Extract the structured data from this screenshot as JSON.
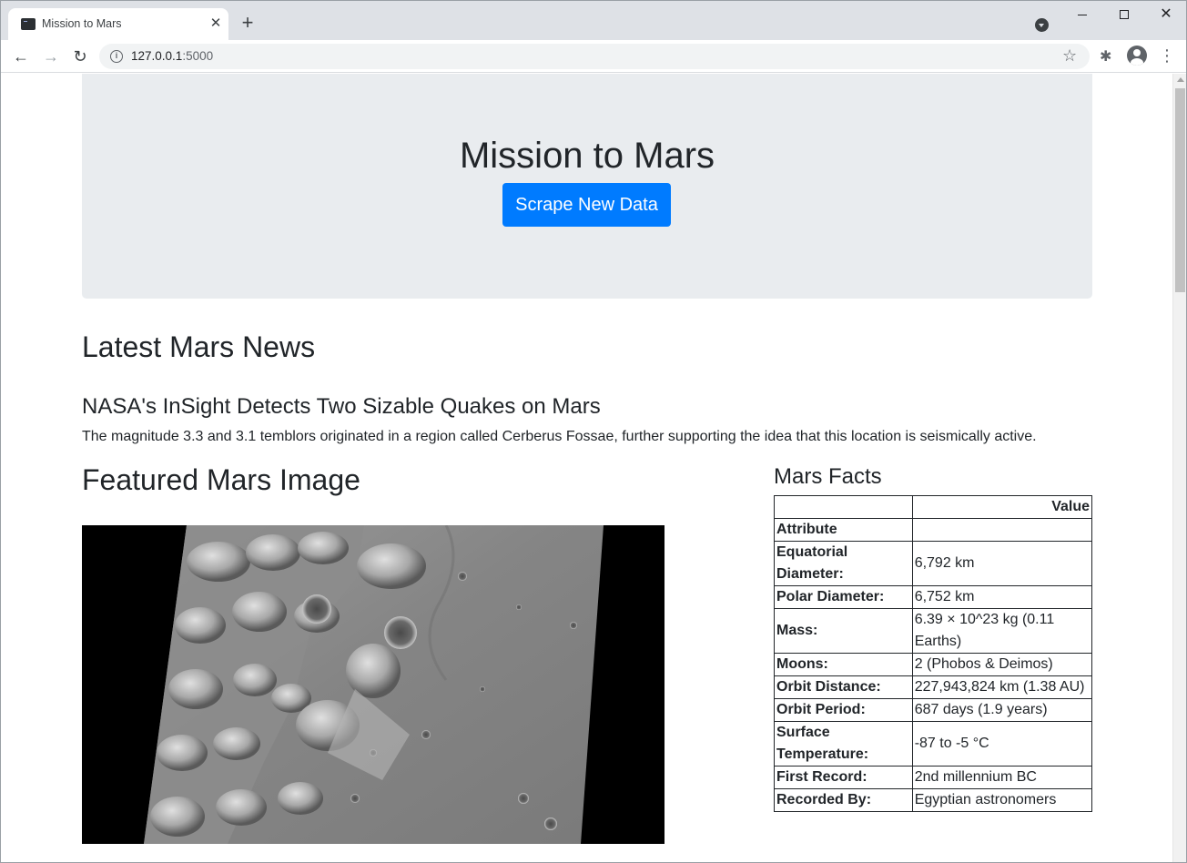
{
  "browser": {
    "tab_title": "Mission to Mars",
    "tab_close_glyph": "✕",
    "new_tab_glyph": "+",
    "url_host": "127.0.0.1",
    "url_port": ":5000",
    "info_glyph": "i",
    "star_glyph": "☆",
    "ext_glyph": "✱",
    "menu_glyph": "⋮",
    "back_glyph": "←",
    "forward_glyph": "→",
    "reload_glyph": "↻",
    "close_glyph": "✕"
  },
  "header": {
    "title": "Mission to Mars",
    "scrape_button": "Scrape New Data"
  },
  "news": {
    "section_title": "Latest Mars News",
    "headline": "NASA's InSight Detects Two Sizable Quakes on Mars",
    "paragraph": "The magnitude 3.3 and 3.1 temblors originated in a region called Cerberus Fossae, further supporting the idea that this location is seismically active."
  },
  "featured_image": {
    "section_title": "Featured Mars Image"
  },
  "facts": {
    "title": "Mars Facts",
    "header_value": "Value",
    "index_name": "Attribute",
    "rows": [
      {
        "label": "Equatorial Diameter:",
        "value": "6,792 km"
      },
      {
        "label": "Polar Diameter:",
        "value": "6,752 km"
      },
      {
        "label": "Mass:",
        "value": "6.39 × 10^23 kg (0.11 Earths)"
      },
      {
        "label": "Moons:",
        "value": "2 (Phobos & Deimos)"
      },
      {
        "label": "Orbit Distance:",
        "value": "227,943,824 km (1.38 AU)"
      },
      {
        "label": "Orbit Period:",
        "value": "687 days (1.9 years)"
      },
      {
        "label": "Surface Temperature:",
        "value": "-87 to -5 °C"
      },
      {
        "label": "First Record:",
        "value": "2nd millennium BC"
      },
      {
        "label": "Recorded By:",
        "value": "Egyptian astronomers"
      }
    ]
  },
  "colors": {
    "primary_button": "#007bff",
    "jumbotron_bg": "#e9ecef",
    "tabstrip_bg": "#dee1e6"
  }
}
